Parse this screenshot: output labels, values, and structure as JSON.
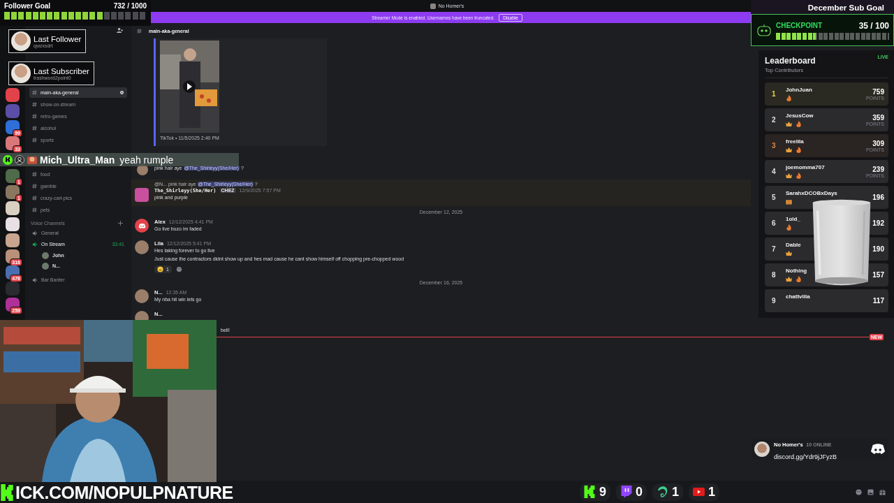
{
  "top_bar": {
    "server_name": "No Homer's"
  },
  "banner": {
    "text": "Streamer Mode is enabled. Usernames have been truncated.",
    "button": "Disable"
  },
  "follower_goal": {
    "title": "Follower Goal",
    "count": "732 / 1000",
    "level": 0.732
  },
  "last_follower": {
    "label": "Last Follower",
    "name": "qwzxsdrt"
  },
  "last_subscriber": {
    "label": "Last Subscriber",
    "name": "trashword2point0"
  },
  "sub_goal": {
    "title": "December Sub Goal",
    "label": "CHECKPOINT",
    "count": "35 / 100",
    "level": 0.35
  },
  "servers": [
    {
      "color": "#e2434b"
    },
    {
      "color": "#5a4fa8"
    },
    {
      "color": "#2f6fd9",
      "badge": "99"
    },
    {
      "color": "#d9777a",
      "badge": "33"
    },
    {
      "color": "#4f6b4a",
      "badge": "1"
    },
    {
      "color": "#8a7760",
      "badge": "1"
    },
    {
      "color": "#d8d0c0"
    },
    {
      "color": "#e8e0e4"
    },
    {
      "color": "#c9a48e"
    },
    {
      "color": "#b99078",
      "badge": "316"
    },
    {
      "color": "#4a6fb0",
      "badge": "476"
    },
    {
      "color": "#2a2b30"
    },
    {
      "color": "#b0309a",
      "badge": "259"
    }
  ],
  "sidebar": {
    "text_channels": [
      {
        "name": "main-aka-general",
        "selected": true
      },
      {
        "name": "show-on-stream",
        "selected": false
      },
      {
        "name": "retro-games",
        "selected": false
      },
      {
        "name": "alcohol",
        "selected": false
      },
      {
        "name": "sports",
        "selected": false
      },
      {
        "name": "food",
        "selected": false
      },
      {
        "name": "gamble",
        "selected": false
      },
      {
        "name": "crazy-carl-pics",
        "selected": false
      },
      {
        "name": "pets",
        "selected": false
      }
    ],
    "voice_header": "Voice Channels",
    "voice_channels": [
      {
        "name": "General",
        "active": false
      },
      {
        "name": "On Stream",
        "active": true,
        "timer": "33:41",
        "users": [
          "John",
          "N..."
        ]
      },
      {
        "name": "Bar Banter",
        "active": false
      }
    ]
  },
  "chat": {
    "channel": "main-aka-general",
    "messages": [
      {
        "kind": "embed",
        "footer": "TikTok • 11/5/2025 2:40 PM"
      },
      {
        "kind": "message",
        "default_avatar": false,
        "text": "pink hair aye",
        "mention": "@The_Shirleyy(She/Her)",
        "suffix": "?"
      },
      {
        "kind": "reply",
        "quote": "@N... pink hair aye",
        "quote_mention": "@The_Shirleyy(She/Her)",
        "quote_suffix": "?",
        "author": "The_Shirleyy(She/Her)",
        "tag": "CHEZ",
        "time": "12/9/2025 7:57 PM",
        "lines": [
          "pink and purple"
        ]
      },
      {
        "kind": "divider",
        "text": "December 12, 2025"
      },
      {
        "kind": "post",
        "default_avatar": true,
        "author": "Alex",
        "time": "12/12/2025 4:41 PM",
        "lines": [
          "Go live bozo im faded"
        ]
      },
      {
        "kind": "post",
        "default_avatar": false,
        "author": "Lila",
        "time": "12/12/2025 5:41 PM",
        "lines": [
          "Hes taking forever to go live",
          "Just cause the contractors didnt show up and hes mad cause he cant show himself off chopping pre-chopped wood"
        ],
        "reaction": "1"
      },
      {
        "kind": "divider",
        "text": "December 16, 2025"
      },
      {
        "kind": "post",
        "default_avatar": false,
        "author": "N...",
        "time": "12:35 AM",
        "lines": [
          "My nba hit win lets go"
        ]
      },
      {
        "kind": "post",
        "default_avatar": false,
        "author": "N..."
      },
      {
        "kind": "tail",
        "text": "bell!"
      }
    ],
    "new_label": "NEW"
  },
  "stream_chat": {
    "user": "Mich_Ultra_Man",
    "text": "yeah rumple"
  },
  "leaderboard": {
    "title": "Leaderboard",
    "subtitle": "Top Contributors",
    "live": "LIVE",
    "rows": [
      {
        "rank": "1",
        "name": "JohnJuan",
        "points": "759",
        "unit": "POINTS",
        "badges": [
          {
            "kind": "flame"
          }
        ],
        "color": "#e8d44a"
      },
      {
        "rank": "2",
        "name": "JesusCow",
        "points": "359",
        "unit": "POINTS",
        "badges": [
          {
            "kind": "crown"
          },
          {
            "kind": "flame"
          }
        ],
        "color": "#e0e0e0"
      },
      {
        "rank": "3",
        "name": "freelila",
        "points": "309",
        "unit": "POINTS",
        "badges": [
          {
            "kind": "crown"
          },
          {
            "kind": "flame"
          }
        ],
        "color": "#d9894a"
      },
      {
        "rank": "4",
        "name": "joemomma707",
        "points": "239",
        "unit": "POINTS",
        "badges": [
          {
            "kind": "crown"
          },
          {
            "kind": "flame"
          }
        ],
        "color": "#e0e0e0"
      },
      {
        "rank": "5",
        "name": "SarahxDCOBxDays",
        "points": "196",
        "badges": [
          {
            "kind": "gift"
          }
        ],
        "color": "#e0e0e0"
      },
      {
        "rank": "6",
        "name": "1old_",
        "points": "192",
        "badges": [
          {
            "kind": "flame"
          }
        ],
        "color": "#e0e0e0"
      },
      {
        "rank": "7",
        "name": "Dable",
        "points": "190",
        "badges": [
          {
            "kind": "crown"
          }
        ],
        "color": "#e0e0e0"
      },
      {
        "rank": "8",
        "name": "Nothing",
        "points": "157",
        "badges": [
          {
            "kind": "crown"
          },
          {
            "kind": "flame"
          }
        ],
        "color": "#e0e0e0"
      },
      {
        "rank": "9",
        "name": "chattvlila",
        "points": "117",
        "color": "#e0e0e0"
      }
    ]
  },
  "discord_widget": {
    "server": "No Homer's",
    "online": "10 ONLINE",
    "invite": "discord.gg/Ydr9jJFyzB"
  },
  "stream_url": "ICK.COM/NOPULPNATURE",
  "counters": [
    {
      "kind": "kick",
      "count": "9"
    },
    {
      "kind": "twitch",
      "count": "0"
    },
    {
      "kind": "rumble",
      "count": "1"
    },
    {
      "kind": "youtube",
      "count": "1"
    }
  ]
}
